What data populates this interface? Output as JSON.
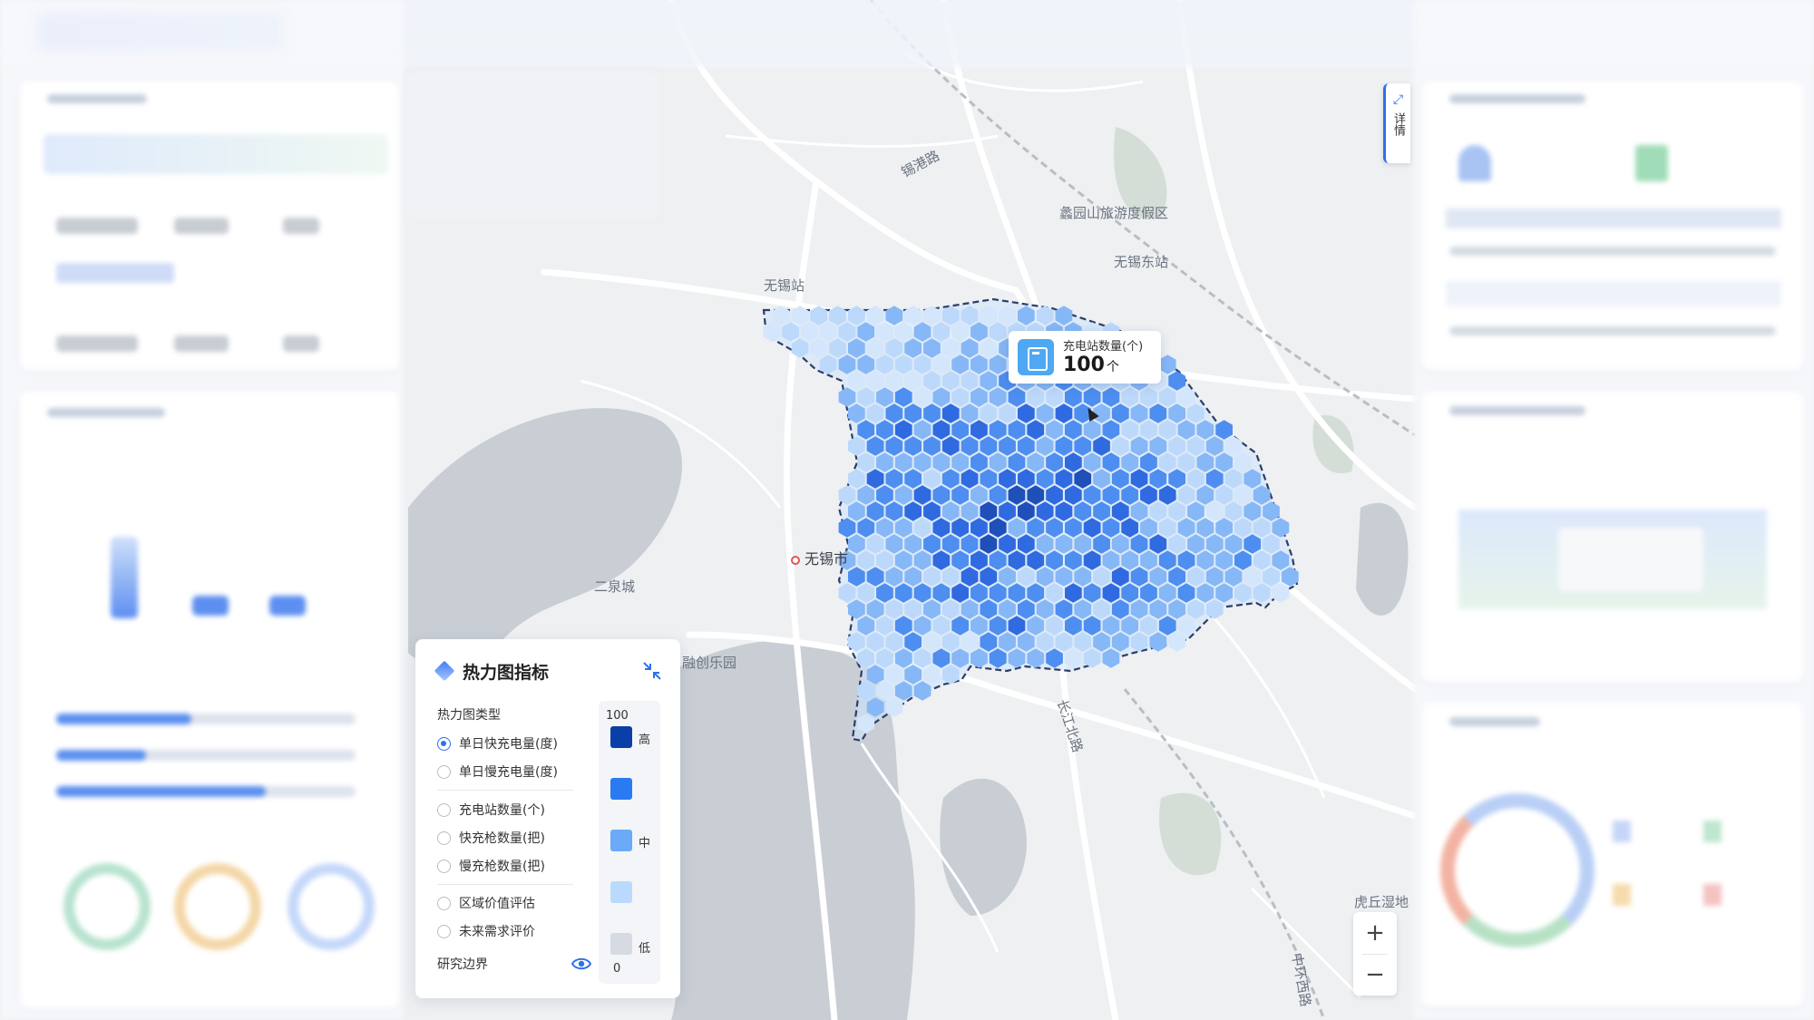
{
  "map": {
    "labels": {
      "scenic": "蠡园山旅游度假区",
      "east_station": "无锡东站",
      "station": "无锡站",
      "city": "无锡市",
      "erquan": "二泉城",
      "park": "融创乐园",
      "road1": "锡港路",
      "road2": "长江北路",
      "road3": "中环西路",
      "hill": "虎丘湿地"
    }
  },
  "tooltip": {
    "label": "充电站数量(个)",
    "value": "100",
    "unit": "个"
  },
  "detail_button": {
    "label": "详情"
  },
  "zoom": {
    "in": "+",
    "out": "−"
  },
  "legend": {
    "title": "热力图指标",
    "section_label": "热力图类型",
    "options": [
      {
        "label": "单日快充电量(度)",
        "selected": true
      },
      {
        "label": "单日慢充电量(度)",
        "selected": false
      },
      {
        "label": "充电站数量(个)",
        "selected": false
      },
      {
        "label": "快充枪数量(把)",
        "selected": false
      },
      {
        "label": "慢充枪数量(把)",
        "selected": false
      },
      {
        "label": "区域价值评估",
        "selected": false
      },
      {
        "label": "未来需求评价",
        "selected": false
      }
    ],
    "boundary_label": "研究边界",
    "scale": {
      "max": "100",
      "min": "0",
      "high": "高",
      "mid": "中",
      "low": "低",
      "colors": [
        "#0b3fa8",
        "#2a7bf2",
        "#6aaaf7",
        "#b9dafc",
        "#d6dbe3"
      ]
    }
  },
  "heat_colors": [
    "#1f4fb8",
    "#2f6ae0",
    "#4d8ef0",
    "#86b7f7",
    "#bcd9fb",
    "#d3e6fc"
  ]
}
